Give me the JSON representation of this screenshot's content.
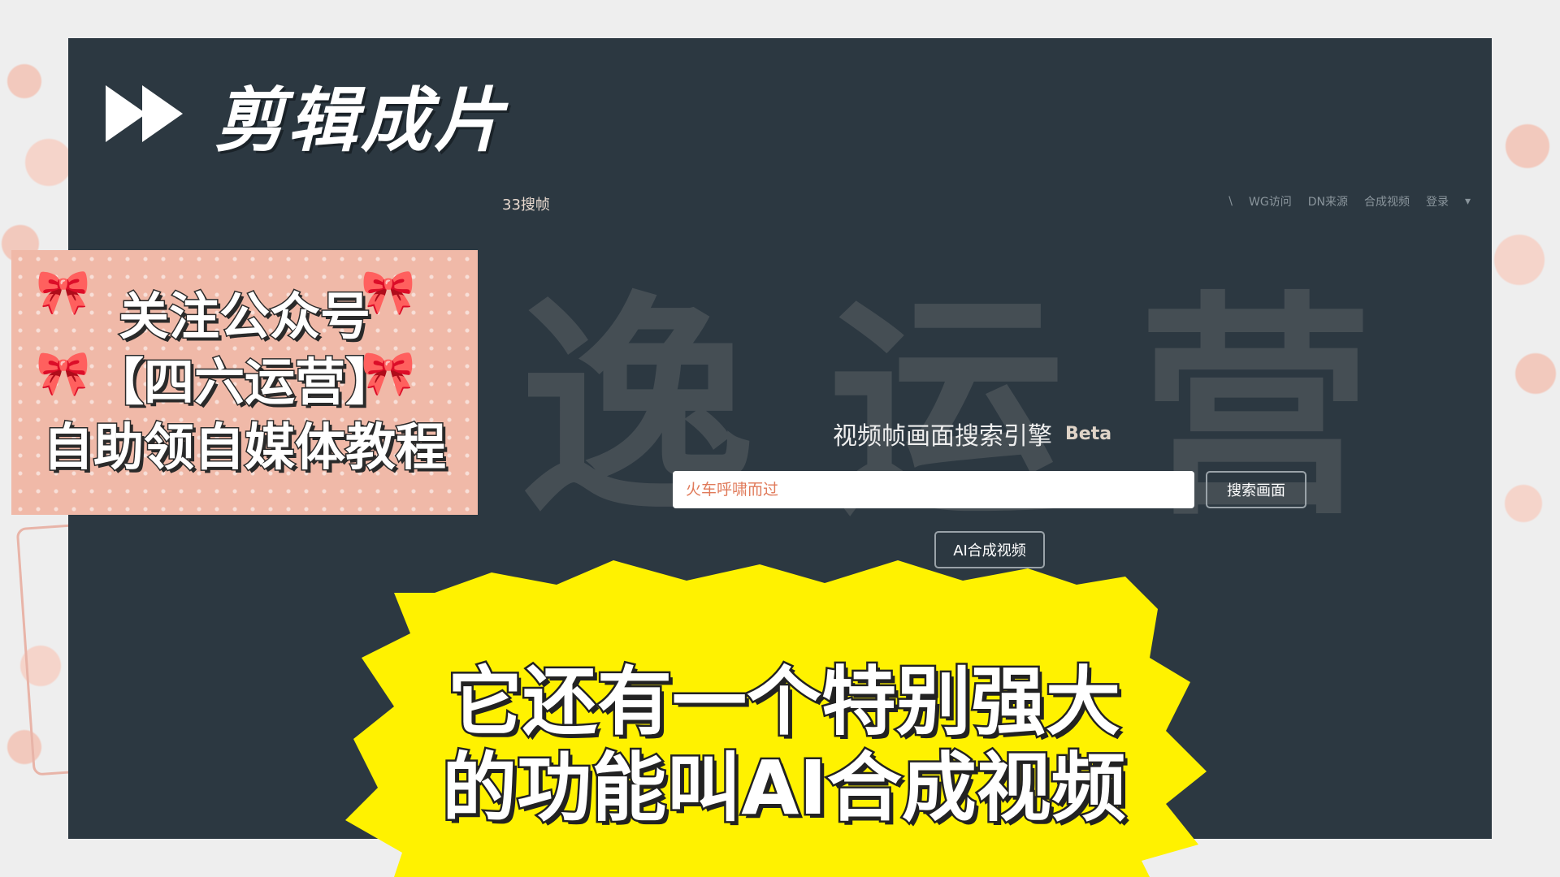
{
  "header": {
    "title": "剪辑成片"
  },
  "app": {
    "brand": "33搜帧",
    "nav": [
      "\\",
      "WG访问",
      "DN来源",
      "合成视频",
      "登录"
    ]
  },
  "watermark": [
    "逸",
    "运",
    "营"
  ],
  "search": {
    "title": "视频帧画面搜索引擎",
    "badge": "Beta",
    "placeholder": "火车呼啸而过",
    "button_label": "搜索画面",
    "ai_button_label": "AI合成视频"
  },
  "promo": {
    "lines": [
      "关注公众号",
      "【四六运营】",
      "自助领自媒体教程"
    ]
  },
  "caption": {
    "lines": [
      "它还有一个特别强大",
      "的功能叫AI合成视频"
    ]
  },
  "colors": {
    "screen_bg": "#2c3841",
    "promo_bg": "#f0b9a8",
    "burst": "#fff200",
    "input_text": "#e07a5a"
  }
}
